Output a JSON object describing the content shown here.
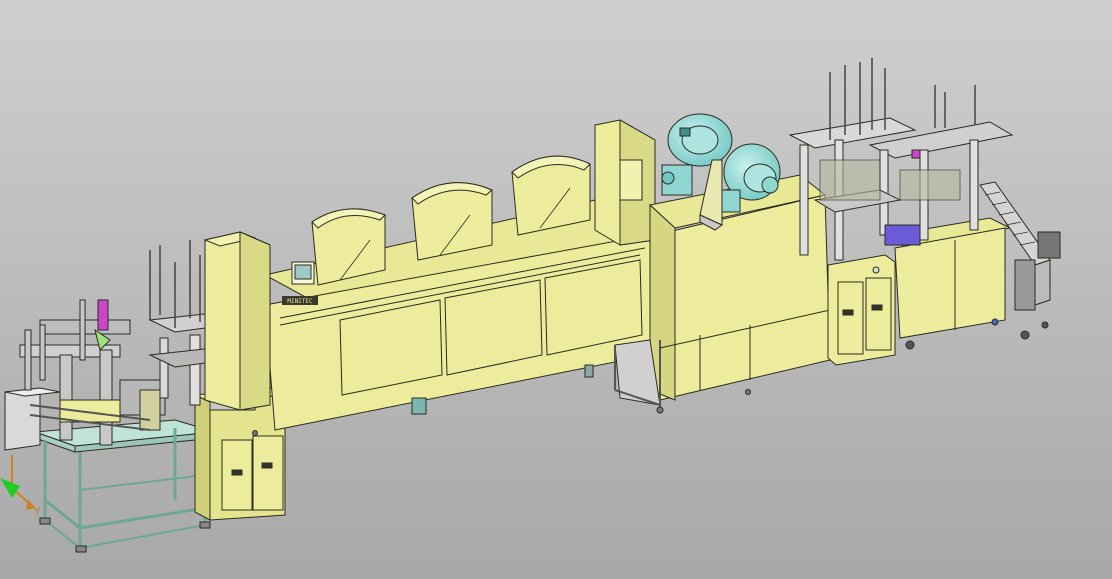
{
  "viewport": {
    "background_top": "#cfcfcf",
    "background_bottom": "#a8a8a8"
  },
  "colors": {
    "machine_body": "#ecec9c",
    "machine_shade": "#d8d880",
    "machine_dark": "#b9b96a",
    "outline": "#2b2b20",
    "frame_cyan": "#bfe3d6",
    "blower_cyan": "#8fd6d2",
    "blower_dark": "#3f8f8c",
    "steel": "#c8c8c8",
    "accent_magenta": "#cc44cc",
    "accent_purple": "#6b5bd6",
    "axis_x": "#d08020",
    "axis_y": "#d08020",
    "axis_z": "#22cc22"
  },
  "axis_triad": {
    "y_label": "Y"
  },
  "control_panel": {
    "brand_plate": "MINITEC"
  }
}
